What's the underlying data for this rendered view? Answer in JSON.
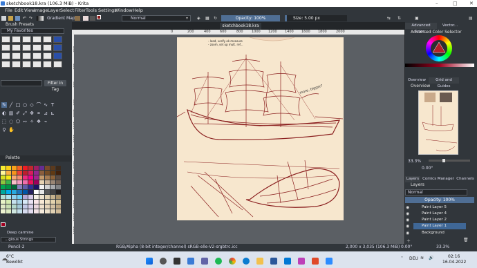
{
  "window": {
    "title": "sketchbook18.kra (106.3 MiB) - Krita"
  },
  "menu": [
    "File",
    "Edit",
    "View",
    "Image",
    "Layer",
    "Select",
    "Filter",
    "Tools",
    "Settings",
    "Window",
    "Help"
  ],
  "toolbar": {
    "gradient_label": "Gradient Map",
    "blend_mode": "Normal",
    "opacity": "Opacity: 100%",
    "size": "Size: 5.00 px"
  },
  "left_panel": {
    "brush_presets_title": "Brush Presets",
    "favorites": "My Favorites",
    "filter_tag": "Filter in Tag",
    "palette_title": "Palette",
    "color_name": "Deep carmine",
    "palette_name": "...gious Strings"
  },
  "document": {
    "tab": "sketchbook18.kra",
    "ruler_ticks": [
      "0",
      "200",
      "400",
      "600",
      "800",
      "1000",
      "1200",
      "1400",
      "1600",
      "1800",
      "2000"
    ],
    "vruler_ticks": [
      "200",
      "400",
      "600",
      "800",
      "1000",
      "1200",
      "1400",
      "1600",
      "1800",
      "2000",
      "2200",
      "2400",
      "2600",
      "2800"
    ]
  },
  "sketch_text": {
    "note1": "- load, verify ok measure",
    "note2": "- zoom, set up mult. ref...",
    "note3": "more, bigger?"
  },
  "right_panel": {
    "adv_tab": "Advanced Color...",
    "vector_tab": "Vector...",
    "adv_title": "Advanced Color Selector",
    "overview_tab": "Overview",
    "grid_tab": "Grid and Guides",
    "overview_title": "Overview",
    "zoom": "33.3%",
    "rotation": "0.00°"
  },
  "layers": {
    "tabs": [
      "Layers",
      "Comics Manager",
      "Channels"
    ],
    "title": "Layers",
    "blend": "Normal",
    "opacity": "Opacity: 100%",
    "items": [
      "Paint Layer 5",
      "Paint Layer 4",
      "Paint Layer 2",
      "Paint Layer 1",
      "Background"
    ],
    "selected": 3
  },
  "status": {
    "brush": "Pencil-2",
    "colorspace": "RGB/Alpha (8-bit integer/channel)  sRGB-elle-V2-srgbtrc.icc",
    "dims": "2,000 x 3,035 (106.3 MiB)",
    "rotation": "0.00°",
    "zoom": "33.3%"
  },
  "taskbar": {
    "temp": "6°C",
    "weather": "Bewölkt",
    "lang": "DEU",
    "time": "02:16",
    "date": "16.04.2022"
  }
}
